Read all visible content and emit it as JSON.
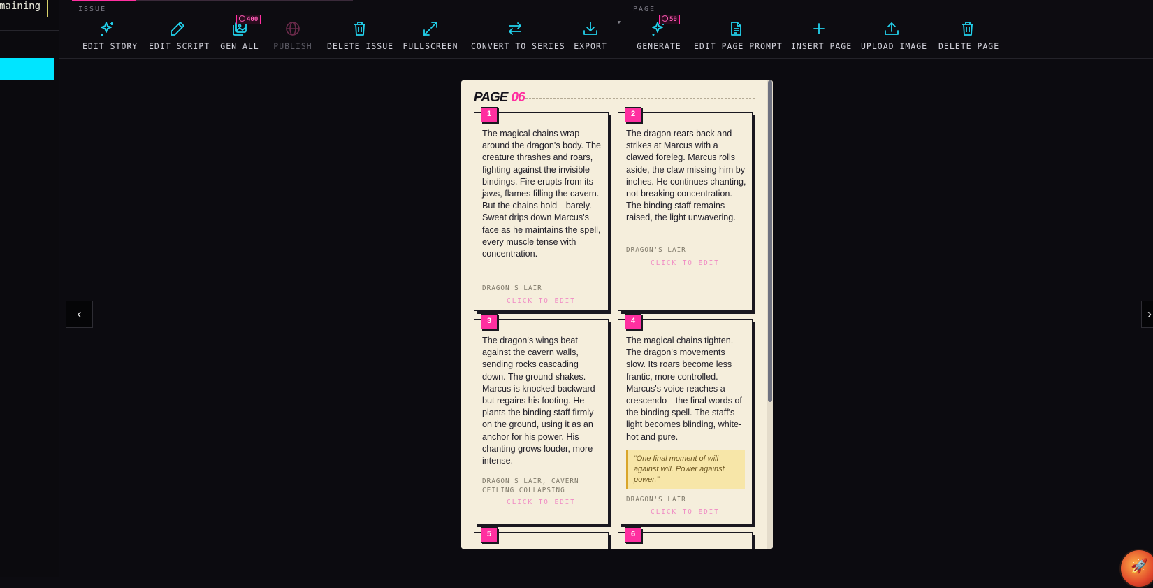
{
  "sidebar": {
    "remaining_label": "maining"
  },
  "toolbar": {
    "progress": 0.23,
    "issue_group_label": "ISSUE",
    "page_group_label": "PAGE",
    "issue_actions": [
      {
        "label": "EDIT STORY",
        "icon": "sparkles-icon"
      },
      {
        "label": "EDIT SCRIPT",
        "icon": "pencil-icon"
      },
      {
        "label": "GEN ALL",
        "icon": "images-icon",
        "badge": "400"
      },
      {
        "label": "PUBLISH",
        "icon": "globe-icon",
        "disabled": true
      },
      {
        "label": "DELETE ISSUE",
        "icon": "trash-icon"
      },
      {
        "label": "FULLSCREEN",
        "icon": "expand-icon"
      },
      {
        "label": "CONVERT TO SERIES",
        "icon": "swap-arrows-icon"
      },
      {
        "label": "EXPORT",
        "icon": "download-icon",
        "caret": "▼"
      }
    ],
    "page_actions": [
      {
        "label": "GENERATE",
        "icon": "sparkles-icon",
        "badge": "50"
      },
      {
        "label": "EDIT PAGE PROMPT",
        "icon": "document-icon"
      },
      {
        "label": "INSERT PAGE",
        "icon": "plus-icon"
      },
      {
        "label": "UPLOAD IMAGE",
        "icon": "upload-icon"
      },
      {
        "label": "DELETE PAGE",
        "icon": "trash-icon"
      }
    ]
  },
  "page": {
    "title_prefix": "PAGE",
    "title_number": "06",
    "panels": [
      {
        "number": "1",
        "text": "The magical chains wrap around the dragon's body. The creature thrashes and roars, fighting against the invisible bindings. Fire erupts from its jaws, flames filling the cavern. But the chains hold—barely. Sweat drips down Marcus's face as he maintains the spell, every muscle tense with concentration.",
        "location": "DRAGON'S LAIR",
        "edit_hint": "CLICK TO EDIT"
      },
      {
        "number": "2",
        "text": "The dragon rears back and strikes at Marcus with a clawed foreleg. Marcus rolls aside, the claw missing him by inches. He continues chanting, not breaking concentration. The binding staff remains raised, the light unwavering.",
        "location": "DRAGON'S LAIR",
        "edit_hint": "CLICK TO EDIT"
      },
      {
        "number": "3",
        "text": "The dragon's wings beat against the cavern walls, sending rocks cascading down. The ground shakes. Marcus is knocked backward but regains his footing. He plants the binding staff firmly on the ground, using it as an anchor for his power. His chanting grows louder, more intense.",
        "location": "DRAGON'S LAIR, CAVERN CEILING COLLAPSING",
        "edit_hint": "CLICK TO EDIT"
      },
      {
        "number": "4",
        "text": "The magical chains tighten. The dragon's movements slow. Its roars become less frantic, more controlled. Marcus's voice reaches a crescendo—the final words of the binding spell. The staff's light becomes blinding, white-hot and pure.",
        "quote": "“One final moment of will against will. Power against power.”",
        "location": "DRAGON'S LAIR",
        "edit_hint": "CLICK TO EDIT"
      },
      {
        "number": "5"
      },
      {
        "number": "6"
      }
    ]
  },
  "nav": {
    "prev_glyph": "‹",
    "next_glyph": "›"
  }
}
